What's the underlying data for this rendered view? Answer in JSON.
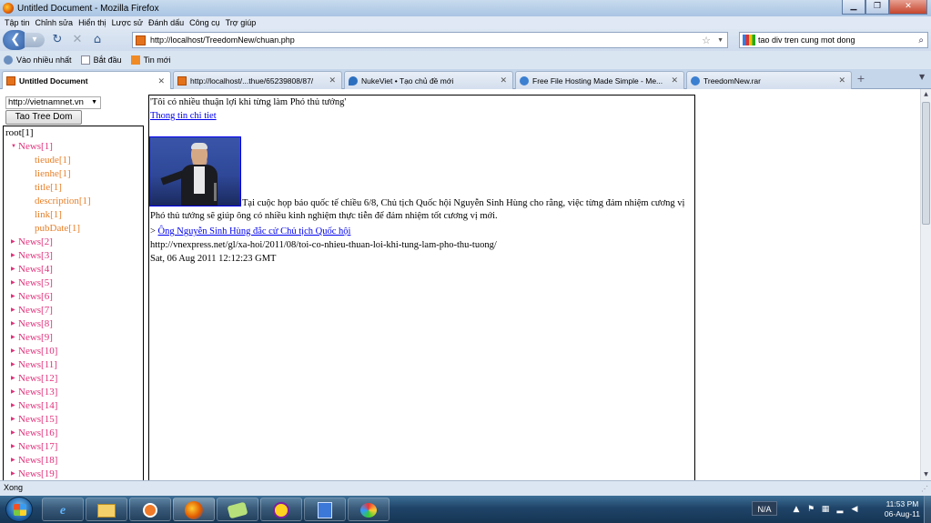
{
  "window": {
    "title": "Untitled Document - Mozilla Firefox"
  },
  "menu": [
    "Tập tin",
    "Chỉnh sửa",
    "Hiển thị",
    "Lược sử",
    "Đánh dấu",
    "Công cụ",
    "Trợ giúp"
  ],
  "nav": {
    "url": "http://localhost/TreedomNew/chuan.php",
    "search": "tao div tren cung mot dong"
  },
  "bookmarks": [
    {
      "label": "Vào nhiều nhất",
      "icon": "gear-icon"
    },
    {
      "label": "Bắt đầu",
      "icon": "page-icon"
    },
    {
      "label": "Tin mới",
      "icon": "rss-icon"
    }
  ],
  "tabs": [
    {
      "label": "Untitled Document",
      "active": true
    },
    {
      "label": "http://localhost/...thue/65239808/87/"
    },
    {
      "label": "NukeViet • Tạo chủ đề mới"
    },
    {
      "label": "Free File Hosting Made Simple - Me..."
    },
    {
      "label": "TreedomNew.rar"
    }
  ],
  "sidebar": {
    "select_value": "http://vietnamnet.vn",
    "button_label": "Tao Tree Dom",
    "root": "root[1]",
    "expanded_node": "News[1]",
    "children": [
      "tieude[1]",
      "lienhe[1]",
      "title[1]",
      "description[1]",
      "link[1]",
      "pubDate[1]"
    ],
    "nodes": [
      "News[2]",
      "News[3]",
      "News[4]",
      "News[5]",
      "News[6]",
      "News[7]",
      "News[8]",
      "News[9]",
      "News[10]",
      "News[11]",
      "News[12]",
      "News[13]",
      "News[14]",
      "News[15]",
      "News[16]",
      "News[17]",
      "News[18]",
      "News[19]"
    ]
  },
  "article": {
    "title": "'Tôi có nhiều thuận lợi khi từng làm Phó thủ tướng'",
    "detail_link": "Thong tin chi tiet",
    "description": "Tại cuộc họp báo quốc tế chiều 6/8, Chủ tịch Quốc hội Nguyễn Sinh Hùng cho rằng, việc từng đảm nhiệm cương vị Phó thủ tướng sẽ giúp ông có nhiều kinh nghiệm thực tiễn để đảm nhiệm tốt cương vị mới.",
    "related_prefix": ">",
    "related_link": "Ông Nguyễn Sinh Hùng đắc cử Chủ tịch Quốc hội",
    "url": "http://vnexpress.net/gl/xa-hoi/2011/08/toi-co-nhieu-thuan-loi-khi-tung-lam-pho-thu-tuong/",
    "date": "Sat, 06 Aug 2011 12:12:23 GMT"
  },
  "status": {
    "text": "Xong"
  },
  "taskbar": {
    "apps": [
      "ie-icon",
      "explorer-icon",
      "media-player-icon",
      "firefox-icon",
      "messenger-icon",
      "yahoo-messenger-icon",
      "word-icon",
      "paint-icon"
    ],
    "tray_label": "N/A",
    "time": "11:53 PM",
    "date": "06-Aug-11"
  }
}
